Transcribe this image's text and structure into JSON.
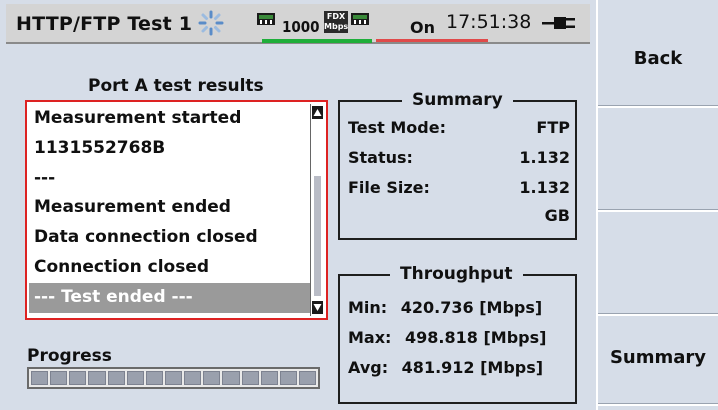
{
  "header": {
    "title": "HTTP/FTP Test 1",
    "speed": "1000",
    "duplex_top": "FDX",
    "duplex_bottom": "Mbps",
    "line_status": "On",
    "time": "17:51:38",
    "icons": [
      "activity-spinner-icon",
      "ethernet-link-icon",
      "power-plug-icon"
    ],
    "colors": {
      "link_bar": "#1fae3a",
      "status_bar": "#e04a4a"
    }
  },
  "softkeys": [
    {
      "label": "Back"
    },
    {
      "label": ""
    },
    {
      "label": ""
    },
    {
      "label": "Summary"
    }
  ],
  "results": {
    "heading": "Port A test results",
    "lines": [
      "Measurement started",
      "1131552768B",
      "---",
      "Measurement ended",
      "Data connection closed",
      "Connection closed",
      "--- Test ended ---"
    ],
    "selected_index": 6,
    "highlight_color": "#dd2222"
  },
  "progress": {
    "label": "Progress",
    "segments_total": 15,
    "segments_filled": 15
  },
  "summary": {
    "title": "Summary",
    "rows": [
      {
        "key": "Test Mode:",
        "value": "FTP"
      },
      {
        "key": "Status:",
        "value": "1.132"
      },
      {
        "key": "File Size:",
        "value": "1.132"
      },
      {
        "key": "",
        "value": "GB"
      }
    ]
  },
  "throughput": {
    "title": "Throughput",
    "rows": [
      {
        "label": "Min:",
        "value": "420.736 [Mbps]"
      },
      {
        "label": "Max:",
        "value": "498.818 [Mbps]"
      },
      {
        "label": "Avg:",
        "value": "481.912 [Mbps]"
      }
    ]
  }
}
